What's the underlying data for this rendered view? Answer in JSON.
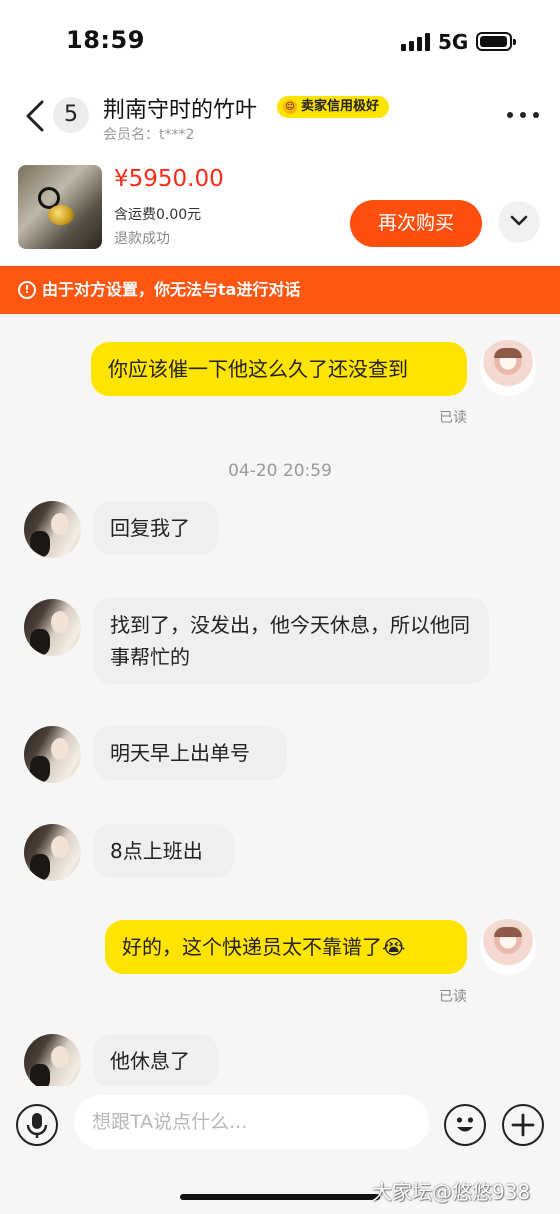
{
  "status_bar": {
    "time": "18:59",
    "network": "5G"
  },
  "header": {
    "unread_count": "5",
    "shop_name": "荆南守时的竹叶",
    "credit_badge": "卖家信用极好",
    "member_label": "会员名：t***2"
  },
  "product": {
    "price": "¥5950.00",
    "shipping": "含运费0.00元",
    "status": "退款成功",
    "buy_again_label": "再次购买"
  },
  "banner": {
    "text": "由于对方设置，你无法与ta进行对话"
  },
  "messages": [
    {
      "from": "me",
      "text": "你应该催一下他这么久了还没查到",
      "read": "已读"
    },
    {
      "from": "timestamp",
      "text": "04-20 20:59"
    },
    {
      "from": "them",
      "text": "回复我了"
    },
    {
      "from": "them",
      "text": "找到了，没发出，他今天休息，所以他同事帮忙的"
    },
    {
      "from": "them",
      "text": "明天早上出单号"
    },
    {
      "from": "them",
      "text": "8点上班出"
    },
    {
      "from": "me",
      "text": "好的，这个快递员太不靠谱了😭",
      "read": "已读"
    },
    {
      "from": "them",
      "text": "他休息了"
    }
  ],
  "input": {
    "placeholder": "想跟TA说点什么..."
  },
  "watermark": "大家坛@悠悠938",
  "colors": {
    "accent": "#ff5712",
    "price": "#ff2a1a",
    "my_bubble": "#ffe400",
    "their_bubble": "#efeff1"
  }
}
